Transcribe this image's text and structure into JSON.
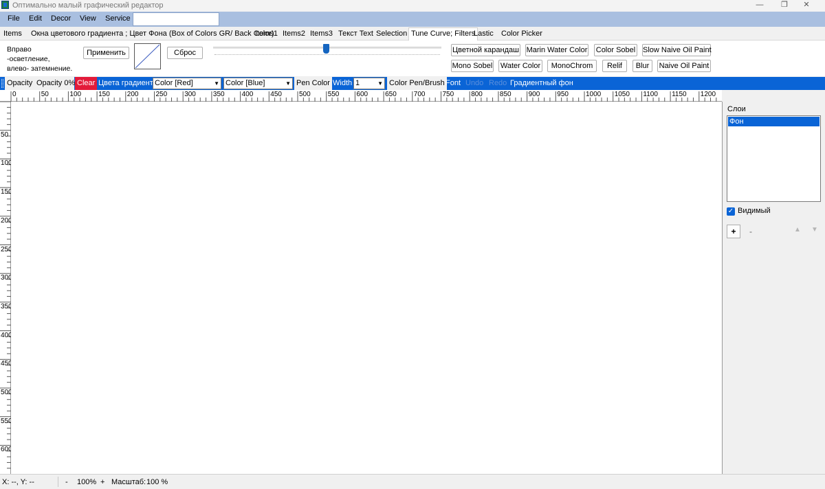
{
  "window": {
    "title": "Оптимально малый графический редактор",
    "minimize_glyph": "—",
    "restore_glyph": "❐",
    "close_glyph": "✕"
  },
  "menu": {
    "items": [
      "File",
      "Edit",
      "Decor",
      "View",
      "Service"
    ],
    "search_value": ""
  },
  "tabs": {
    "items": [
      "Items",
      "Окна цветового градиента ; Цвет Фона (Box of Colors GR/ Back Color)",
      "Items1",
      "Items2",
      "Items3",
      "Текст Text",
      "Selection",
      "Tune Curve; Filters",
      "Lastic",
      "Color Picker"
    ],
    "active": "Tune Curve; Filters"
  },
  "filters_panel": {
    "hint_line1": "Вправо -осветление,",
    "hint_line2": "влево- затемнение.",
    "apply_label": "Применить",
    "reset_label": "Сброс",
    "slider_value_percent": 50,
    "filters_row1": [
      "Цветной карандаш",
      "Marin Water Color",
      "Color Sobel",
      "Slow Naive Oil Paint"
    ],
    "filters_row2": [
      "Mono Sobel",
      "Water Color",
      "MonoChrom",
      "Relif",
      "Blur",
      "Naive Oil Paint"
    ]
  },
  "toolbar": {
    "opacity": "Opacity",
    "opacity_value": "Opacity 0%",
    "clear": "Clear",
    "gradient_colors": "Цвета градиента",
    "color_red": "Color [Red]",
    "color_blue": "Color [Blue]",
    "pen_color": "Pen Color",
    "width_label": "Width",
    "width_value": "1",
    "color_pen_brush": "Color Pen/Brush",
    "font": "Font",
    "undo": "Undo",
    "redo": "Redo",
    "gradient_bg": "Градиентный фон",
    "dropdown_arrow": "▼"
  },
  "rulers": {
    "horizontal": [
      "0",
      "50",
      "100",
      "150",
      "200",
      "250",
      "300",
      "350",
      "400",
      "450",
      "500",
      "550",
      "600",
      "650",
      "700",
      "750",
      "800",
      "850",
      "900",
      "950",
      "1000",
      "1050",
      "1100",
      "1150",
      "1200"
    ],
    "vertical": [
      "0",
      "50",
      "100",
      "150",
      "200",
      "250",
      "300",
      "350",
      "400",
      "450",
      "500",
      "550",
      "600"
    ]
  },
  "layers": {
    "title": "Слои",
    "items": [
      "Фон"
    ],
    "visible_label": "Видимый",
    "visible_checked": true,
    "add_glyph": "+",
    "remove_glyph": "-",
    "up_glyph": "▲",
    "down_glyph": "▼"
  },
  "status": {
    "coords": "X: --, Y: --",
    "zoom_out": "-",
    "zoom": "100%",
    "zoom_in": "+",
    "scale_label": "Масштаб:",
    "scale_value": "100 %"
  },
  "colors": {
    "accent": "#0a64d6",
    "menubar": "#a9bfe0",
    "clear_button": "#e31b3a"
  }
}
